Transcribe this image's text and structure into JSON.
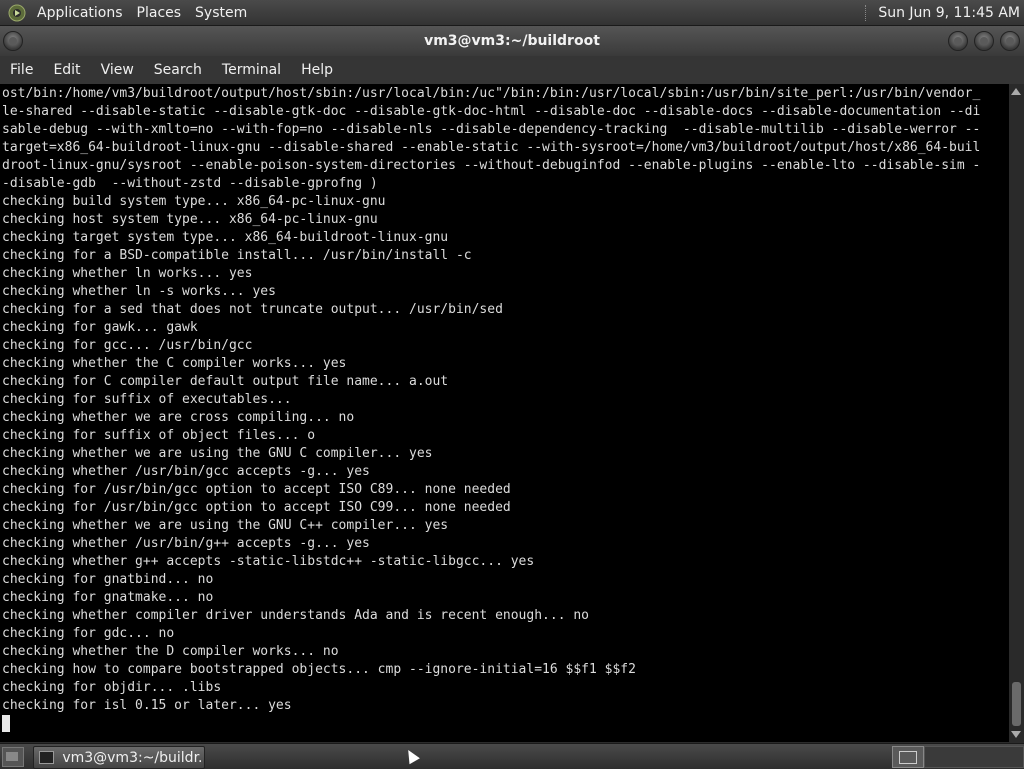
{
  "top_panel": {
    "menus": [
      "Applications",
      "Places",
      "System"
    ],
    "clock": "Sun Jun  9, 11:45 AM"
  },
  "window": {
    "title": "vm3@vm3:~/buildroot",
    "menu": [
      "File",
      "Edit",
      "View",
      "Search",
      "Terminal",
      "Help"
    ]
  },
  "terminal": {
    "lines": [
      "ost/bin:/home/vm3/buildroot/output/host/sbin:/usr/local/bin:/uc\"/bin:/bin:/usr/local/sbin:/usr/bin/site_perl:/usr/bin/vendor_",
      "le-shared --disable-static --disable-gtk-doc --disable-gtk-doc-html --disable-doc --disable-docs --disable-documentation --di",
      "sable-debug --with-xmlto=no --with-fop=no --disable-nls --disable-dependency-tracking  --disable-multilib --disable-werror --",
      "target=x86_64-buildroot-linux-gnu --disable-shared --enable-static --with-sysroot=/home/vm3/buildroot/output/host/x86_64-buil",
      "droot-linux-gnu/sysroot --enable-poison-system-directories --without-debuginfod --enable-plugins --enable-lto --disable-sim -",
      "-disable-gdb  --without-zstd --disable-gprofng )",
      "checking build system type... x86_64-pc-linux-gnu",
      "checking host system type... x86_64-pc-linux-gnu",
      "checking target system type... x86_64-buildroot-linux-gnu",
      "checking for a BSD-compatible install... /usr/bin/install -c",
      "checking whether ln works... yes",
      "checking whether ln -s works... yes",
      "checking for a sed that does not truncate output... /usr/bin/sed",
      "checking for gawk... gawk",
      "checking for gcc... /usr/bin/gcc",
      "checking whether the C compiler works... yes",
      "checking for C compiler default output file name... a.out",
      "checking for suffix of executables...",
      "checking whether we are cross compiling... no",
      "checking for suffix of object files... o",
      "checking whether we are using the GNU C compiler... yes",
      "checking whether /usr/bin/gcc accepts -g... yes",
      "checking for /usr/bin/gcc option to accept ISO C89... none needed",
      "checking for /usr/bin/gcc option to accept ISO C99... none needed",
      "checking whether we are using the GNU C++ compiler... yes",
      "checking whether /usr/bin/g++ accepts -g... yes",
      "checking whether g++ accepts -static-libstdc++ -static-libgcc... yes",
      "checking for gnatbind... no",
      "checking for gnatmake... no",
      "checking whether compiler driver understands Ada and is recent enough... no",
      "checking for gdc... no",
      "checking whether the D compiler works... no",
      "checking how to compare bootstrapped objects... cmp --ignore-initial=16 $$f1 $$f2",
      "checking for objdir... .libs",
      "checking for isl 0.15 or later... yes"
    ]
  },
  "taskbar": {
    "window_label": "vm3@vm3:~/buildr..."
  }
}
